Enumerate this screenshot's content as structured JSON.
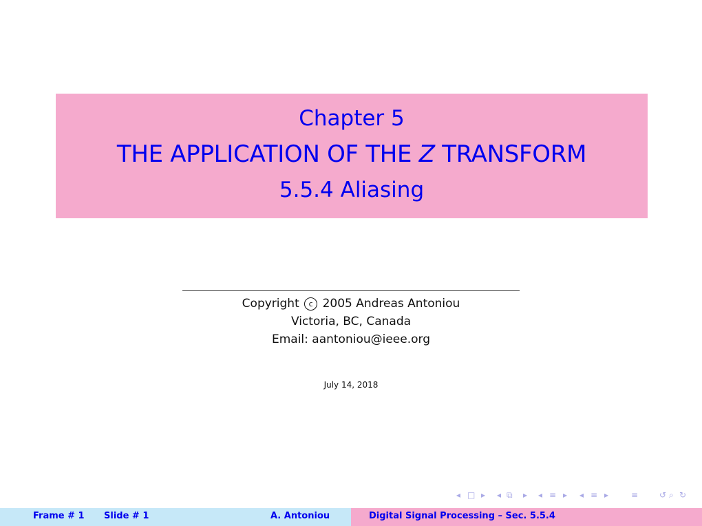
{
  "title_block": {
    "chapter": "Chapter 5",
    "title_pre": "THE APPLICATION OF THE ",
    "title_var": "Z",
    "title_post": " TRANSFORM",
    "section": "5.5.4 Aliasing"
  },
  "author_block": {
    "copyright_prefix": "Copyright",
    "copyright_symbol": "c",
    "copyright_suffix": "2005 Andreas Antoniou",
    "location": "Victoria, BC, Canada",
    "email": "Email: aantoniou@ieee.org"
  },
  "date": "July 14, 2018",
  "nav": {
    "left_arrow": "◂",
    "right_arrow": "▸",
    "frame_icon": "□",
    "subsection_icon": "⧉",
    "section_icon": "≡",
    "back_icon": "↺",
    "search_icon": "⌕",
    "forward_icon": "↻"
  },
  "footer": {
    "frame": "Frame # 1",
    "slide": "Slide # 1",
    "author": "A. Antoniou",
    "course": "Digital Signal Processing – Sec. 5.5.4"
  }
}
